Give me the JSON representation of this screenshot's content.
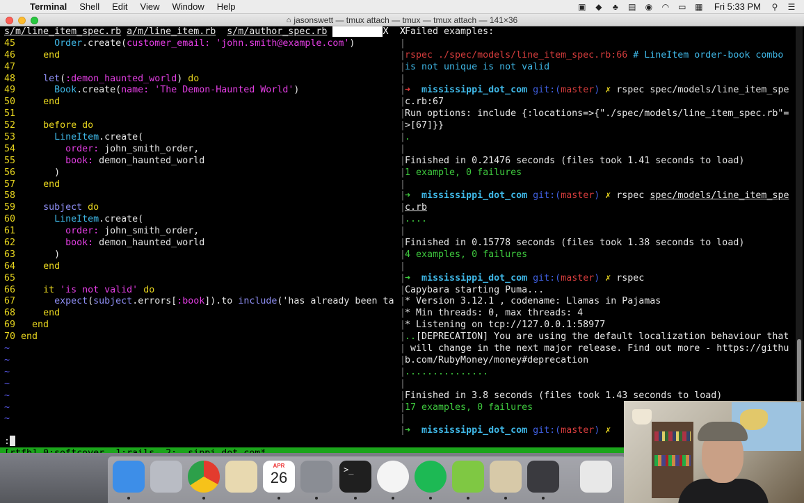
{
  "menubar": {
    "app_name": "Terminal",
    "menus": [
      "Shell",
      "Edit",
      "View",
      "Window",
      "Help"
    ],
    "clock": "Fri 5:33 PM",
    "status_icons": [
      "camera-icon",
      "dropbox-icon",
      "evernote-icon",
      "docker-icon",
      "sync-icon",
      "wifi-icon",
      "battery-icon",
      "flag-icon",
      "search-icon",
      "menu-icon"
    ]
  },
  "window": {
    "title": "jasonswett — tmux attach — tmux — tmux attach — 141×36"
  },
  "vim": {
    "tabline": [
      {
        "label": "s/m/line_item_spec.rb",
        "active": true
      },
      {
        "label": "a/m/line_item.rb",
        "active": false
      },
      {
        "label": "s/m/author_spec.rb",
        "active": false
      }
    ],
    "close_glyph": "X",
    "lines": [
      {
        "n": "45",
        "code": "      Order.create(customer_email: 'john.smith@example.com')"
      },
      {
        "n": "46",
        "code": "    end"
      },
      {
        "n": "47",
        "code": ""
      },
      {
        "n": "48",
        "code": "    let(:demon_haunted_world) do"
      },
      {
        "n": "49",
        "code": "      Book.create(name: 'The Demon-Haunted World')"
      },
      {
        "n": "50",
        "code": "    end"
      },
      {
        "n": "51",
        "code": ""
      },
      {
        "n": "52",
        "code": "    before do"
      },
      {
        "n": "53",
        "code": "      LineItem.create("
      },
      {
        "n": "54",
        "code": "        order: john_smith_order,"
      },
      {
        "n": "55",
        "code": "        book: demon_haunted_world"
      },
      {
        "n": "56",
        "code": "      )"
      },
      {
        "n": "57",
        "code": "    end"
      },
      {
        "n": "58",
        "code": ""
      },
      {
        "n": "59",
        "code": "    subject do"
      },
      {
        "n": "60",
        "code": "      LineItem.create("
      },
      {
        "n": "61",
        "code": "        order: john_smith_order,"
      },
      {
        "n": "62",
        "code": "        book: demon_haunted_world"
      },
      {
        "n": "63",
        "code": "      )"
      },
      {
        "n": "64",
        "code": "    end"
      },
      {
        "n": "65",
        "code": ""
      },
      {
        "n": "66",
        "code": "    it 'is not valid' do"
      },
      {
        "n": "67",
        "code": "      expect(subject.errors[:book]).to include('has already been ta"
      },
      {
        "n": "68",
        "code": "    end"
      },
      {
        "n": "69",
        "code": "  end"
      },
      {
        "n": "70",
        "code": "end"
      }
    ],
    "tilde": "~",
    "tilde_count": 7,
    "cmdline": ":"
  },
  "shell": {
    "prompt_dir": "mississippi_dot_com",
    "prompt_git": "git:(",
    "prompt_branch": "master",
    "prompt_close": ")",
    "prompt_x": "✗",
    "arrow": "➜",
    "lines": [
      {
        "kind": "plain",
        "text": "Failed examples:"
      },
      {
        "kind": "blank",
        "text": ""
      },
      {
        "kind": "failed",
        "red": "rspec ./spec/models/line_item_spec.rb:66",
        "cyan": " # LineItem order-book combo"
      },
      {
        "kind": "cyan",
        "text": "is not unique is not valid"
      },
      {
        "kind": "blank",
        "text": ""
      },
      {
        "kind": "prompt",
        "arrow_color": "red",
        "cmd": " rspec spec/models/line_item_spe",
        "underline": false
      },
      {
        "kind": "plain",
        "text": "c.rb:67"
      },
      {
        "kind": "plain",
        "text": "Run options: include {:locations=>{\"./spec/models/line_item_spec.rb\"="
      },
      {
        "kind": "plain",
        "text": ">[67]}}"
      },
      {
        "kind": "green",
        "text": "."
      },
      {
        "kind": "blank",
        "text": ""
      },
      {
        "kind": "plain",
        "text": "Finished in 0.21476 seconds (files took 1.41 seconds to load)"
      },
      {
        "kind": "green",
        "text": "1 example, 0 failures"
      },
      {
        "kind": "blank",
        "text": ""
      },
      {
        "kind": "prompt-ul",
        "arrow_color": "green",
        "cmd_plain": " rspec ",
        "cmd_ul": "spec/models/line_item_spe"
      },
      {
        "kind": "ul",
        "text": "c.rb"
      },
      {
        "kind": "green",
        "text": "...."
      },
      {
        "kind": "blank",
        "text": ""
      },
      {
        "kind": "plain",
        "text": "Finished in 0.15778 seconds (files took 1.38 seconds to load)"
      },
      {
        "kind": "green",
        "text": "4 examples, 0 failures"
      },
      {
        "kind": "blank",
        "text": ""
      },
      {
        "kind": "prompt",
        "arrow_color": "green",
        "cmd": " rspec",
        "underline": false
      },
      {
        "kind": "plain",
        "text": "Capybara starting Puma..."
      },
      {
        "kind": "plain",
        "text": "* Version 3.12.1 , codename: Llamas in Pajamas"
      },
      {
        "kind": "plain",
        "text": "* Min threads: 0, max threads: 4"
      },
      {
        "kind": "plain",
        "text": "* Listening on tcp://127.0.0.1:58977"
      },
      {
        "kind": "dep",
        "green": "..",
        "text": "[DEPRECATION] You are using the default localization behaviour that"
      },
      {
        "kind": "plain",
        "text": " will change in the next major release. Find out more - https://githu"
      },
      {
        "kind": "plain",
        "text": "b.com/RubyMoney/money#deprecation"
      },
      {
        "kind": "green",
        "text": "..............."
      },
      {
        "kind": "blank",
        "text": ""
      },
      {
        "kind": "plain",
        "text": "Finished in 3.8 seconds (files took 1.43 seconds to load)"
      },
      {
        "kind": "green",
        "text": "17 examples, 0 failures"
      },
      {
        "kind": "blank",
        "text": ""
      },
      {
        "kind": "prompt",
        "arrow_color": "green",
        "cmd": "",
        "underline": false
      }
    ]
  },
  "tmux": {
    "status": "[rtfb] 0:softcover  1:rails- 2:..sippi_dot_com*"
  },
  "dock": {
    "calendar_month": "APR",
    "calendar_day": "26",
    "apps": [
      "Finder",
      "Launchpad",
      "Chrome",
      "Mail",
      "Calendar",
      "System Preferences",
      "Terminal",
      "Slack",
      "Spotify",
      "Evernote",
      "Preview",
      "Screen Recorder",
      "Downloads"
    ]
  },
  "colors": {
    "tmux_green": "#1ba51b",
    "vim_yellow": "#e8d61f",
    "vim_magenta": "#e33ee3",
    "vim_cyan": "#3fb7e6"
  }
}
